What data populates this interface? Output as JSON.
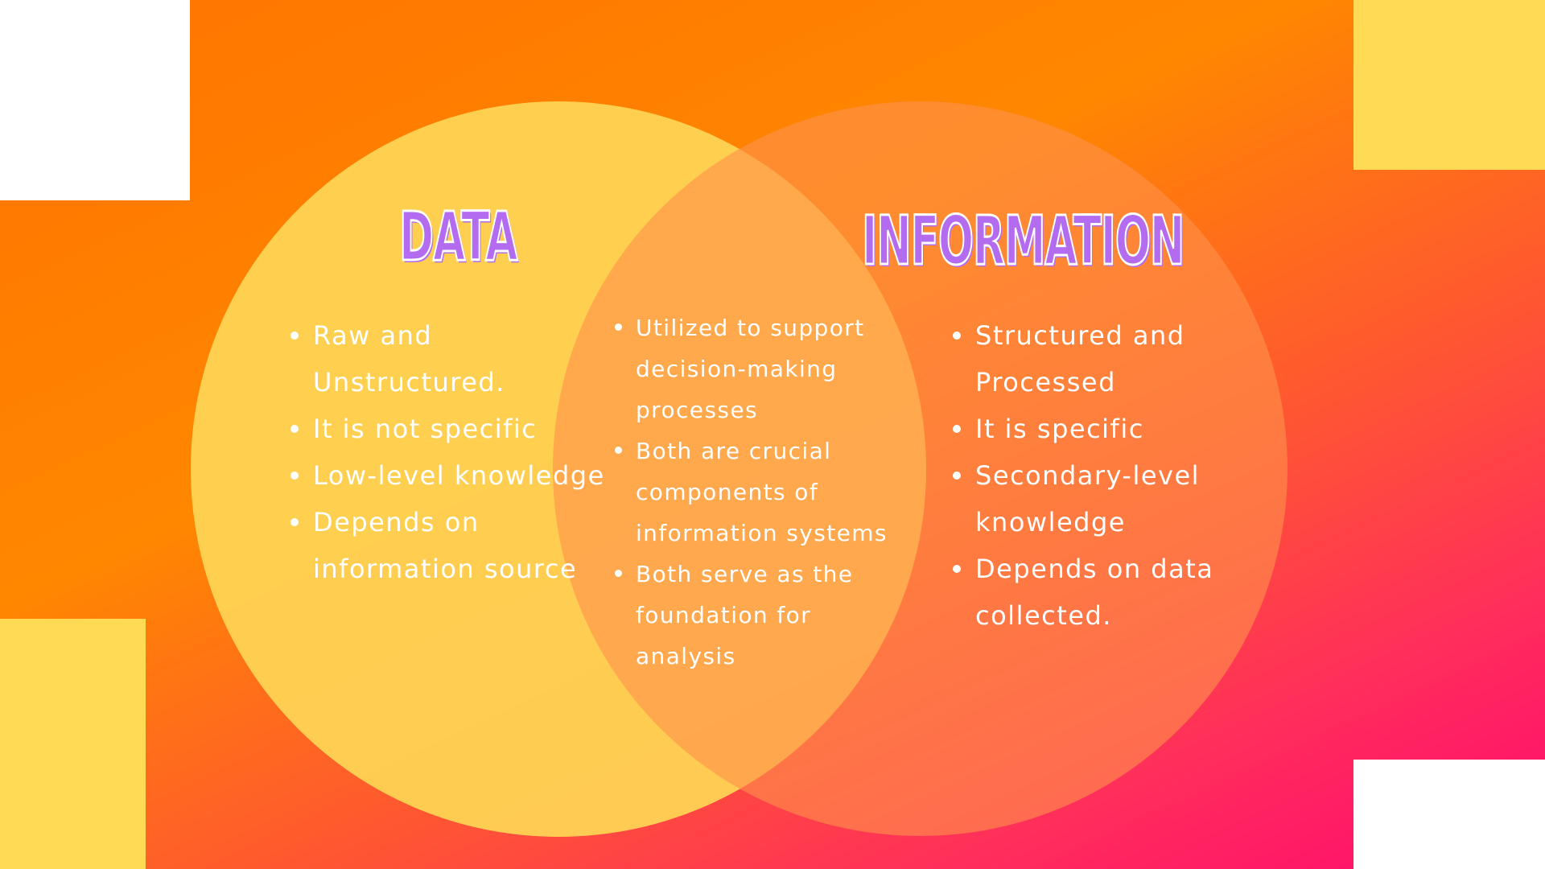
{
  "diagram": {
    "type": "venn",
    "colors": {
      "background_start": "#ff7300",
      "background_end": "#ff0a70",
      "left_circle": "#ffd555",
      "right_circle": "#ff914b",
      "title_fill": "#b36bf0",
      "title_outline": "#ffffff",
      "text": "#ffffff",
      "accent_block": "#ffda55"
    },
    "left": {
      "title": "DATA",
      "items": [
        "Raw and Unstructured.",
        "It is not specific",
        "Low-level knowledge",
        "Depends on information source"
      ]
    },
    "right": {
      "title": "INFORMATION",
      "items": [
        "Structured and Processed",
        "It is specific",
        "Secondary-level knowledge",
        "Depends on data collected."
      ]
    },
    "overlap": {
      "items": [
        "Utilized to support decision-making processes",
        "Both are crucial components of information systems",
        "Both serve as the foundation for analysis"
      ]
    }
  }
}
